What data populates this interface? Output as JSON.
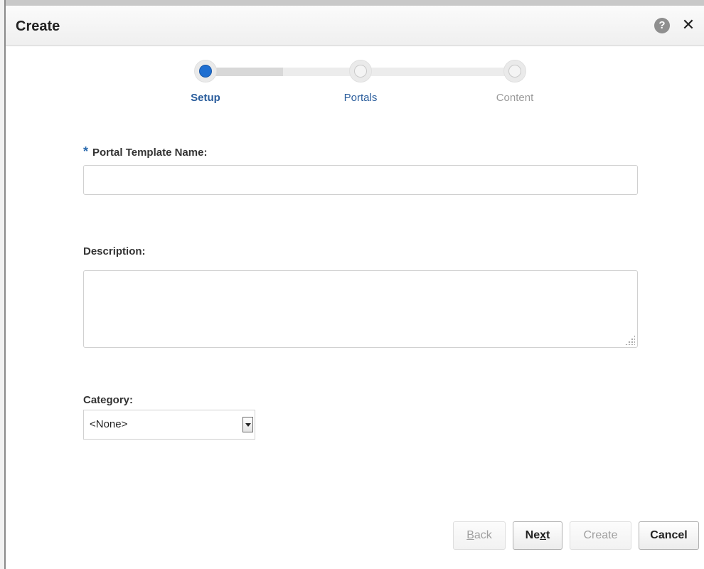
{
  "dialog": {
    "title": "Create",
    "help_glyph": "?",
    "close_glyph": "✕",
    "icons": [
      "help-icon",
      "close-icon"
    ]
  },
  "train": {
    "steps": [
      {
        "label": "Setup",
        "state": "current"
      },
      {
        "label": "Portals",
        "state": "enabled"
      },
      {
        "label": "Content",
        "state": "disabled"
      }
    ]
  },
  "form": {
    "name": {
      "required_marker": "*",
      "label": "Portal Template Name:",
      "value": ""
    },
    "description": {
      "label": "Description:",
      "value": ""
    },
    "category": {
      "label": "Category:",
      "selected": "<None>"
    }
  },
  "buttons": {
    "back": {
      "pre": "",
      "mnemonic": "B",
      "post": "ack",
      "state": "disabled"
    },
    "next": {
      "pre": "Ne",
      "mnemonic": "x",
      "post": "t",
      "state": "enabled"
    },
    "create": {
      "label": "Create",
      "state": "disabled"
    },
    "cancel": {
      "label": "Cancel",
      "state": "enabled"
    }
  },
  "colors": {
    "accent": "#1f6fd1",
    "link": "#2a5d9c",
    "required": "#2a6aae"
  }
}
